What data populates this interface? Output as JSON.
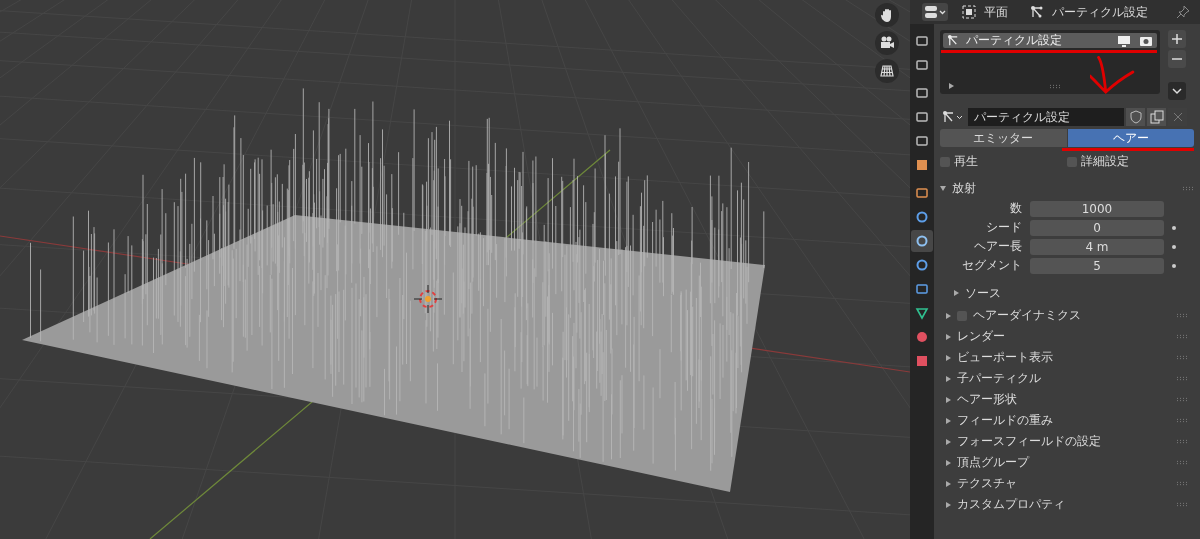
{
  "header": {
    "object_name": "平面",
    "context": "パーティクル設定"
  },
  "property_tabs": [
    {
      "selected": false
    },
    {
      "selected": false
    },
    {
      "selected": false
    },
    {
      "selected": false
    },
    {
      "selected": false
    },
    {
      "selected": false
    },
    {
      "selected": false
    },
    {
      "selected": false
    },
    {
      "selected": true
    },
    {
      "selected": false
    },
    {
      "selected": false
    },
    {
      "selected": false
    },
    {
      "selected": false
    },
    {
      "selected": false
    }
  ],
  "particle_slots": [
    {
      "name": "パーティクル設定",
      "selected": true
    }
  ],
  "datablock": {
    "name": "パーティクル設定"
  },
  "type_tabs": [
    {
      "label": "エミッター",
      "selected": false
    },
    {
      "label": "ヘアー",
      "selected": true
    }
  ],
  "options": [
    {
      "label": "再生",
      "checked": false
    },
    {
      "label": "詳細設定",
      "checked": false
    }
  ],
  "emission": {
    "title": "放射",
    "expanded": true,
    "fields": [
      {
        "label": "数",
        "value": "1000",
        "animatable": false
      },
      {
        "label": "シード",
        "value": "0",
        "animatable": true
      },
      {
        "label": "ヘアー長",
        "value": "4 m",
        "animatable": true
      },
      {
        "label": "セグメント",
        "value": "5",
        "animatable": true
      }
    ],
    "subpanel": {
      "title": "ソース",
      "expanded": false
    }
  },
  "panels": [
    {
      "title": "ヘアーダイナミクス",
      "kind": "toggle",
      "checked": false,
      "expanded": false
    },
    {
      "title": "レンダー",
      "kind": "plain",
      "expanded": false
    },
    {
      "title": "ビューポート表示",
      "kind": "plain",
      "expanded": false
    },
    {
      "title": "子パーティクル",
      "kind": "plain",
      "expanded": false
    },
    {
      "title": "ヘアー形状",
      "kind": "plain",
      "expanded": false
    },
    {
      "title": "フィールドの重み",
      "kind": "plain",
      "expanded": false
    },
    {
      "title": "フォースフィールドの設定",
      "kind": "plain",
      "expanded": false
    },
    {
      "title": "頂点グループ",
      "kind": "plain",
      "expanded": false
    },
    {
      "title": "テクスチャ",
      "kind": "plain",
      "expanded": false
    },
    {
      "title": "カスタムプロパティ",
      "kind": "plain",
      "expanded": false
    }
  ]
}
